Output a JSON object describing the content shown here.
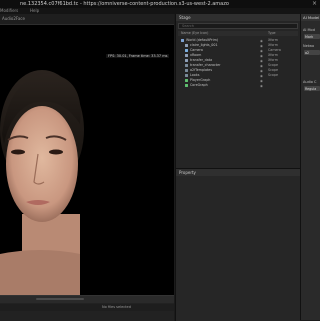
{
  "window": {
    "title": "ne.132354.c07f61bd.tc - https://omniverse-content-production.s3-us-west-2.amazo",
    "close_glyph": "×"
  },
  "menu": {
    "items": [
      "Modifiers",
      "Help"
    ]
  },
  "viewport": {
    "tab": "Audio2Face",
    "fps_text": "FPS: 30.01, Frame time: 33.37 ms",
    "status": "No files selected"
  },
  "stage": {
    "title": "Stage",
    "search_placeholder": "Search",
    "columns": {
      "name": "Name (Eye Icon)",
      "type": "Type"
    },
    "rows": [
      {
        "name": "World (defaultPrim)",
        "type": "Xform",
        "icon": "world-icon",
        "color": "#7fa4d6",
        "indent": 0
      },
      {
        "name": "claire_lights_001",
        "type": "Xform",
        "icon": "xform-icon",
        "color": "#8fa0b8",
        "indent": 1
      },
      {
        "name": "Camera",
        "type": "Camera",
        "icon": "camera-icon",
        "color": "#7db0e0",
        "indent": 1
      },
      {
        "name": "xRoom",
        "type": "Xform",
        "icon": "xform-icon",
        "color": "#8fa0b8",
        "indent": 1
      },
      {
        "name": "transfer_data",
        "type": "Xform",
        "icon": "xform-icon",
        "color": "#8fa0b8",
        "indent": 1
      },
      {
        "name": "transfer_character",
        "type": "Scope",
        "icon": "scope-icon",
        "color": "#7a8a9a",
        "indent": 1
      },
      {
        "name": "a2fTemplates",
        "type": "Scope",
        "icon": "scope-icon",
        "color": "#7a8a9a",
        "indent": 1
      },
      {
        "name": "Looks",
        "type": "Scope",
        "icon": "scope-icon",
        "color": "#7a8a9a",
        "indent": 1
      },
      {
        "name": "PlayerGraph",
        "type": "",
        "icon": "graph-icon",
        "color": "#5fbf6f",
        "indent": 1
      },
      {
        "name": "CoreGraph",
        "type": "",
        "icon": "graph-icon",
        "color": "#5fbf6f",
        "indent": 1
      }
    ]
  },
  "properties": {
    "title": "Property"
  },
  "right_panel": {
    "title": "AI Model",
    "model_label": "AI Mod",
    "model_value": "Mark",
    "network_label": "Netwo",
    "network_value": "a2",
    "audio_label": "Audio C",
    "audio_value": "Regula"
  }
}
